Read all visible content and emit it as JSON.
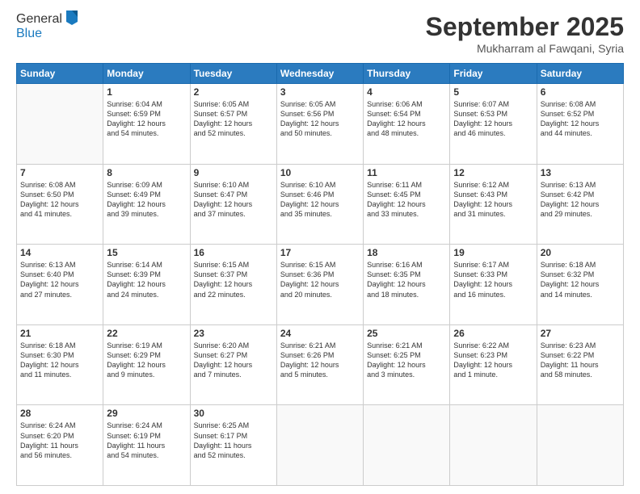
{
  "header": {
    "logo_general": "General",
    "logo_blue": "Blue",
    "month_title": "September 2025",
    "location": "Mukharram al Fawqani, Syria"
  },
  "days_of_week": [
    "Sunday",
    "Monday",
    "Tuesday",
    "Wednesday",
    "Thursday",
    "Friday",
    "Saturday"
  ],
  "weeks": [
    [
      {
        "day": "",
        "lines": []
      },
      {
        "day": "1",
        "lines": [
          "Sunrise: 6:04 AM",
          "Sunset: 6:59 PM",
          "Daylight: 12 hours",
          "and 54 minutes."
        ]
      },
      {
        "day": "2",
        "lines": [
          "Sunrise: 6:05 AM",
          "Sunset: 6:57 PM",
          "Daylight: 12 hours",
          "and 52 minutes."
        ]
      },
      {
        "day": "3",
        "lines": [
          "Sunrise: 6:05 AM",
          "Sunset: 6:56 PM",
          "Daylight: 12 hours",
          "and 50 minutes."
        ]
      },
      {
        "day": "4",
        "lines": [
          "Sunrise: 6:06 AM",
          "Sunset: 6:54 PM",
          "Daylight: 12 hours",
          "and 48 minutes."
        ]
      },
      {
        "day": "5",
        "lines": [
          "Sunrise: 6:07 AM",
          "Sunset: 6:53 PM",
          "Daylight: 12 hours",
          "and 46 minutes."
        ]
      },
      {
        "day": "6",
        "lines": [
          "Sunrise: 6:08 AM",
          "Sunset: 6:52 PM",
          "Daylight: 12 hours",
          "and 44 minutes."
        ]
      }
    ],
    [
      {
        "day": "7",
        "lines": [
          "Sunrise: 6:08 AM",
          "Sunset: 6:50 PM",
          "Daylight: 12 hours",
          "and 41 minutes."
        ]
      },
      {
        "day": "8",
        "lines": [
          "Sunrise: 6:09 AM",
          "Sunset: 6:49 PM",
          "Daylight: 12 hours",
          "and 39 minutes."
        ]
      },
      {
        "day": "9",
        "lines": [
          "Sunrise: 6:10 AM",
          "Sunset: 6:47 PM",
          "Daylight: 12 hours",
          "and 37 minutes."
        ]
      },
      {
        "day": "10",
        "lines": [
          "Sunrise: 6:10 AM",
          "Sunset: 6:46 PM",
          "Daylight: 12 hours",
          "and 35 minutes."
        ]
      },
      {
        "day": "11",
        "lines": [
          "Sunrise: 6:11 AM",
          "Sunset: 6:45 PM",
          "Daylight: 12 hours",
          "and 33 minutes."
        ]
      },
      {
        "day": "12",
        "lines": [
          "Sunrise: 6:12 AM",
          "Sunset: 6:43 PM",
          "Daylight: 12 hours",
          "and 31 minutes."
        ]
      },
      {
        "day": "13",
        "lines": [
          "Sunrise: 6:13 AM",
          "Sunset: 6:42 PM",
          "Daylight: 12 hours",
          "and 29 minutes."
        ]
      }
    ],
    [
      {
        "day": "14",
        "lines": [
          "Sunrise: 6:13 AM",
          "Sunset: 6:40 PM",
          "Daylight: 12 hours",
          "and 27 minutes."
        ]
      },
      {
        "day": "15",
        "lines": [
          "Sunrise: 6:14 AM",
          "Sunset: 6:39 PM",
          "Daylight: 12 hours",
          "and 24 minutes."
        ]
      },
      {
        "day": "16",
        "lines": [
          "Sunrise: 6:15 AM",
          "Sunset: 6:37 PM",
          "Daylight: 12 hours",
          "and 22 minutes."
        ]
      },
      {
        "day": "17",
        "lines": [
          "Sunrise: 6:15 AM",
          "Sunset: 6:36 PM",
          "Daylight: 12 hours",
          "and 20 minutes."
        ]
      },
      {
        "day": "18",
        "lines": [
          "Sunrise: 6:16 AM",
          "Sunset: 6:35 PM",
          "Daylight: 12 hours",
          "and 18 minutes."
        ]
      },
      {
        "day": "19",
        "lines": [
          "Sunrise: 6:17 AM",
          "Sunset: 6:33 PM",
          "Daylight: 12 hours",
          "and 16 minutes."
        ]
      },
      {
        "day": "20",
        "lines": [
          "Sunrise: 6:18 AM",
          "Sunset: 6:32 PM",
          "Daylight: 12 hours",
          "and 14 minutes."
        ]
      }
    ],
    [
      {
        "day": "21",
        "lines": [
          "Sunrise: 6:18 AM",
          "Sunset: 6:30 PM",
          "Daylight: 12 hours",
          "and 11 minutes."
        ]
      },
      {
        "day": "22",
        "lines": [
          "Sunrise: 6:19 AM",
          "Sunset: 6:29 PM",
          "Daylight: 12 hours",
          "and 9 minutes."
        ]
      },
      {
        "day": "23",
        "lines": [
          "Sunrise: 6:20 AM",
          "Sunset: 6:27 PM",
          "Daylight: 12 hours",
          "and 7 minutes."
        ]
      },
      {
        "day": "24",
        "lines": [
          "Sunrise: 6:21 AM",
          "Sunset: 6:26 PM",
          "Daylight: 12 hours",
          "and 5 minutes."
        ]
      },
      {
        "day": "25",
        "lines": [
          "Sunrise: 6:21 AM",
          "Sunset: 6:25 PM",
          "Daylight: 12 hours",
          "and 3 minutes."
        ]
      },
      {
        "day": "26",
        "lines": [
          "Sunrise: 6:22 AM",
          "Sunset: 6:23 PM",
          "Daylight: 12 hours",
          "and 1 minute."
        ]
      },
      {
        "day": "27",
        "lines": [
          "Sunrise: 6:23 AM",
          "Sunset: 6:22 PM",
          "Daylight: 11 hours",
          "and 58 minutes."
        ]
      }
    ],
    [
      {
        "day": "28",
        "lines": [
          "Sunrise: 6:24 AM",
          "Sunset: 6:20 PM",
          "Daylight: 11 hours",
          "and 56 minutes."
        ]
      },
      {
        "day": "29",
        "lines": [
          "Sunrise: 6:24 AM",
          "Sunset: 6:19 PM",
          "Daylight: 11 hours",
          "and 54 minutes."
        ]
      },
      {
        "day": "30",
        "lines": [
          "Sunrise: 6:25 AM",
          "Sunset: 6:17 PM",
          "Daylight: 11 hours",
          "and 52 minutes."
        ]
      },
      {
        "day": "",
        "lines": []
      },
      {
        "day": "",
        "lines": []
      },
      {
        "day": "",
        "lines": []
      },
      {
        "day": "",
        "lines": []
      }
    ]
  ]
}
